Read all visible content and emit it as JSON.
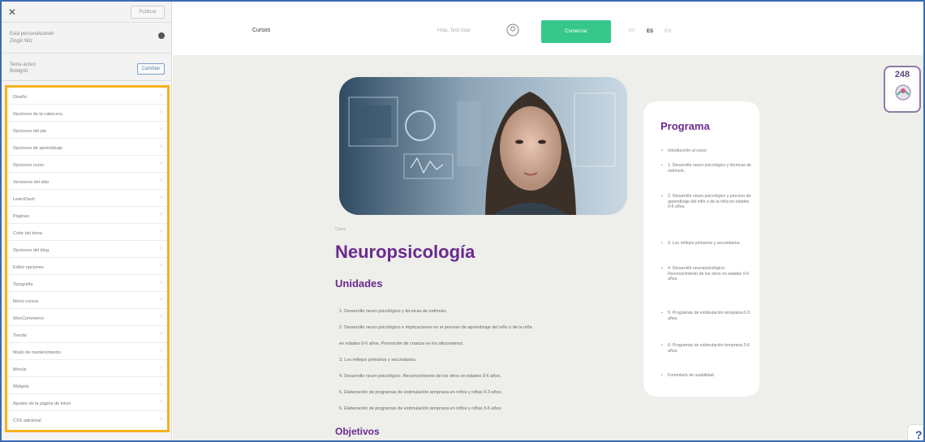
{
  "sidebar": {
    "close_icon": "close-icon",
    "publish_label": "Publicar",
    "info_line1": "Está personalizando",
    "info_line2": "Zingiri Wiz",
    "theme_line1": "Tema activo",
    "theme_line2": "Boldgrid",
    "change_label": "Cambiar",
    "items": [
      {
        "label": "Diseño"
      },
      {
        "label": "Opciones de la cabecera"
      },
      {
        "label": "Opciones del pie"
      },
      {
        "label": "Opciones de aprendizaje"
      },
      {
        "label": "Opciones curso"
      },
      {
        "label": "Versiones del sitio"
      },
      {
        "label": "LearnDash"
      },
      {
        "label": "Páginas"
      },
      {
        "label": "Color del tema"
      },
      {
        "label": "Opciones del blog"
      },
      {
        "label": "Editor opciones"
      },
      {
        "label": "Tipografía"
      },
      {
        "label": "Menú cursos"
      },
      {
        "label": "WooCommerce"
      },
      {
        "label": "Tienda"
      },
      {
        "label": "Modo de mantenimiento"
      },
      {
        "label": "Menús"
      },
      {
        "label": "Widgets"
      },
      {
        "label": "Ajustes de la página de inicio"
      },
      {
        "label": "CSS adicional"
      }
    ]
  },
  "header": {
    "nav_cursos": "Cursos",
    "greeting": "Hola, Test User",
    "cta": "Comenzar",
    "languages": [
      "PT",
      "ES",
      "EN"
    ],
    "active_language": "ES"
  },
  "course": {
    "category": "Curso",
    "title": "Neuropsicología",
    "units_heading": "Unidades",
    "units": [
      "1. Desarrollo neuro psicológico y técnicas de estímulo.",
      "2. Desarrollo neuro psicológico e implicaciones en el proceso de aprendizaje del niño o de la niña",
      "en edades 0-6 años. Promoción de crianza en los aficionamos.",
      "3. Los reflejos primarios y secundarios.",
      "4. Desarrollo neuro psicológico. Reconocimiento de los otros en edades 0-6 años.",
      "5. Elaboración de programas de estimulación temprana en niños y niñas 0-3 años.",
      "6. Elaboración de programas de estimulación temprana en niños y niñas 3-6 años."
    ],
    "objectives_heading": "Objetivos"
  },
  "program": {
    "title": "Programa",
    "items": [
      "Introducción al curso",
      "1. Desarrollo neuro psicológico y técnicas de estímulo.",
      "2. Desarrollo neuro psicológico y proceso de aprendizaje del niño o de la niña en edades 0-6 años.",
      "3. Los reflejos primarios y secundarios.",
      "4. Desarrollo neuropsicológico. Reconocimiento de los otros en edades 0-6 años.",
      "5. Programas de estimulación temprana 0-3 años.",
      "6. Programas de estimulación temprana 3-6 años.",
      "Formulario de usabilidad"
    ]
  },
  "badge": {
    "count": "248"
  },
  "help_corner": "?"
}
